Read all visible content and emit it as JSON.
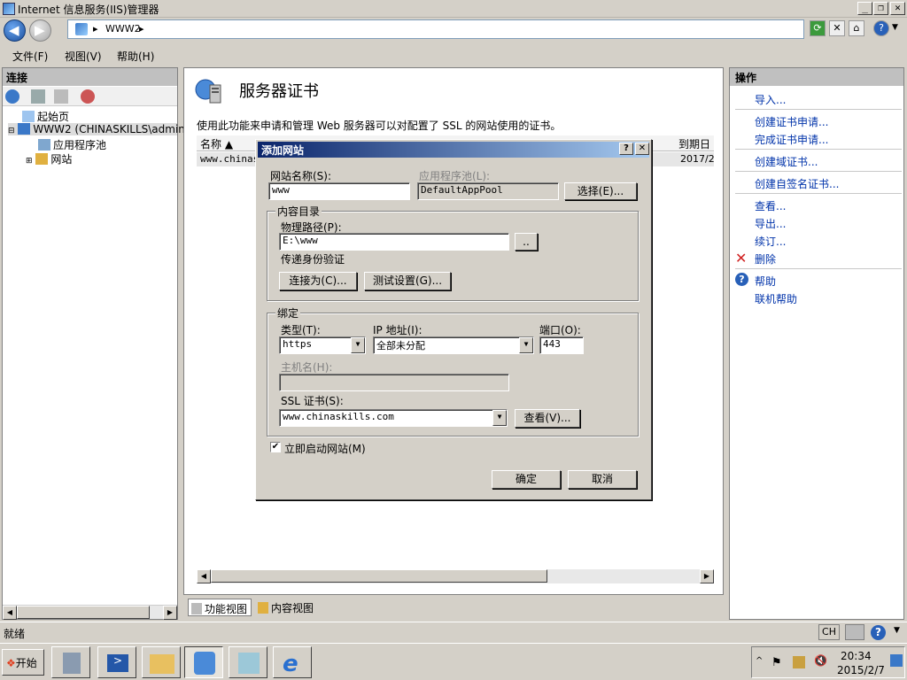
{
  "window": {
    "title": "Internet 信息服务(IIS)管理器"
  },
  "address": {
    "crumb": "WWW2"
  },
  "menu": {
    "items": [
      "文件(F)",
      "视图(V)",
      "帮助(H)"
    ]
  },
  "left": {
    "header": "连接",
    "tree": {
      "start": "起始页",
      "server": "WWW2 (CHINASKILLS\\administ",
      "apppools": "应用程序池",
      "sites": "网站"
    }
  },
  "center": {
    "title": "服务器证书",
    "desc": "使用此功能来申请和管理 Web 服务器可以对配置了 SSL 的网站使用的证书。",
    "columns": {
      "name": "名称 ▲",
      "expire": "到期日"
    },
    "row": {
      "name": "www.chinas",
      "expire": "2017/2"
    }
  },
  "tabs": {
    "feature": "功能视图",
    "content": "内容视图"
  },
  "right": {
    "header": "操作",
    "actions": {
      "import": "导入...",
      "create_req": "创建证书申请...",
      "complete_req": "完成证书申请...",
      "create_domain": "创建域证书...",
      "create_self": "创建自签名证书...",
      "view": "查看...",
      "export": "导出...",
      "renew": "续订...",
      "delete": "删除",
      "help": "帮助",
      "online_help": "联机帮助"
    }
  },
  "status": {
    "text": "就绪",
    "ime": "CH"
  },
  "taskbar": {
    "start": "开始",
    "time": "20:34",
    "date": "2015/2/7"
  },
  "dialog": {
    "title": "添加网站",
    "site_name_label": "网站名称(S):",
    "site_name_value": "www",
    "app_pool_label": "应用程序池(L):",
    "app_pool_value": "DefaultAppPool",
    "select_btn": "选择(E)...",
    "content_group": "内容目录",
    "physical_path_label": "物理路径(P):",
    "physical_path_value": "E:\\www",
    "browse_btn": "..",
    "auth_label": "传递身份验证",
    "connect_as_btn": "连接为(C)...",
    "test_settings_btn": "测试设置(G)...",
    "binding_group": "绑定",
    "type_label": "类型(T):",
    "type_value": "https",
    "ip_label": "IP 地址(I):",
    "ip_value": "全部未分配",
    "port_label": "端口(O):",
    "port_value": "443",
    "host_label": "主机名(H):",
    "host_value": "",
    "ssl_label": "SSL 证书(S):",
    "ssl_value": "www.chinaskills.com",
    "view_btn": "查看(V)...",
    "start_now_label": "立即启动网站(M)",
    "start_now_checked": "✔",
    "ok_btn": "确定",
    "cancel_btn": "取消"
  }
}
